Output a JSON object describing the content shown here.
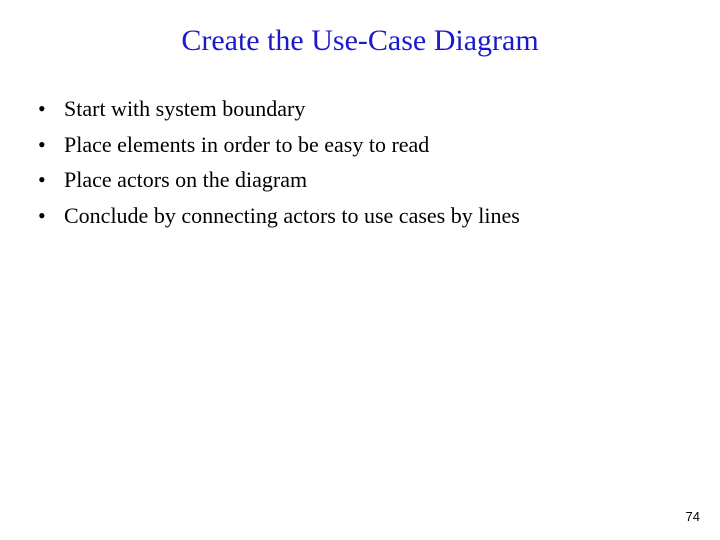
{
  "title": "Create the Use-Case Diagram",
  "bullets": [
    "Start with system boundary",
    "Place elements in order to be easy to read",
    "Place actors on the diagram",
    "Conclude by connecting actors to use cases by lines"
  ],
  "page_number": "74"
}
